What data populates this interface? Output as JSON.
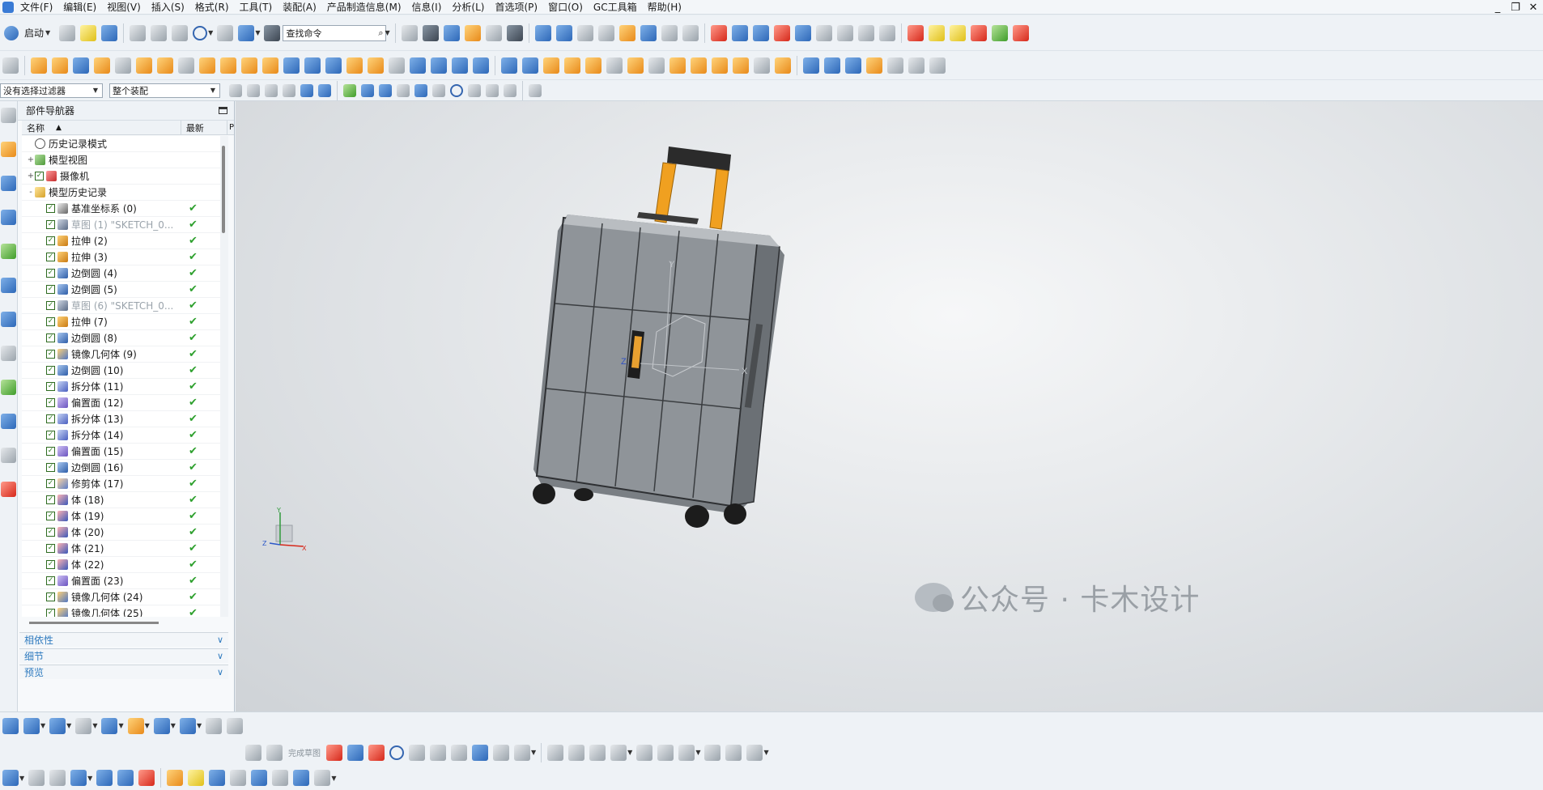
{
  "menu": [
    "文件(F)",
    "编辑(E)",
    "视图(V)",
    "插入(S)",
    "格式(R)",
    "工具(T)",
    "装配(A)",
    "产品制造信息(M)",
    "信息(I)",
    "分析(L)",
    "首选项(P)",
    "窗口(O)",
    "GC工具箱",
    "帮助(H)"
  ],
  "window_controls": [
    "_",
    "❐",
    "✕"
  ],
  "toolbar": {
    "start_label": "启动",
    "search_placeholder": "查找命令",
    "selection_filter": "没有选择过滤器",
    "assembly_scope": "整个装配"
  },
  "navigator": {
    "title": "部件导航器",
    "col_name": "名称",
    "col_latest": "最新",
    "col_extra": "P",
    "nodes": [
      {
        "expander": "",
        "checked": false,
        "icon": "hist",
        "label": "历史记录模式",
        "latest": ""
      },
      {
        "expander": "+",
        "checked": false,
        "icon": "model",
        "label": "模型视图",
        "latest": ""
      },
      {
        "expander": "+",
        "checked": true,
        "icon": "cam",
        "label": "摄像机",
        "latest": ""
      },
      {
        "expander": "-",
        "checked": false,
        "icon": "folder",
        "label": "模型历史记录",
        "latest": ""
      }
    ],
    "features": [
      {
        "icon": "datum",
        "label": "基准坐标系 (0)",
        "grey": false
      },
      {
        "icon": "sketch",
        "label": "草图 (1) \"SKETCH_0...",
        "grey": true
      },
      {
        "icon": "extrude",
        "label": "拉伸 (2)",
        "grey": false
      },
      {
        "icon": "extrude",
        "label": "拉伸 (3)",
        "grey": false
      },
      {
        "icon": "blend",
        "label": "边倒圆 (4)",
        "grey": false
      },
      {
        "icon": "blend",
        "label": "边倒圆 (5)",
        "grey": false
      },
      {
        "icon": "sketch",
        "label": "草图 (6) \"SKETCH_0...",
        "grey": true
      },
      {
        "icon": "extrude",
        "label": "拉伸 (7)",
        "grey": false
      },
      {
        "icon": "blend",
        "label": "边倒圆 (8)",
        "grey": false
      },
      {
        "icon": "mirror",
        "label": "镜像几何体 (9)",
        "grey": false
      },
      {
        "icon": "blend",
        "label": "边倒圆 (10)",
        "grey": false
      },
      {
        "icon": "split",
        "label": "拆分体 (11)",
        "grey": false
      },
      {
        "icon": "offset",
        "label": "偏置面 (12)",
        "grey": false
      },
      {
        "icon": "split",
        "label": "拆分体 (13)",
        "grey": false
      },
      {
        "icon": "split",
        "label": "拆分体 (14)",
        "grey": false
      },
      {
        "icon": "offset",
        "label": "偏置面 (15)",
        "grey": false
      },
      {
        "icon": "blend",
        "label": "边倒圆 (16)",
        "grey": false
      },
      {
        "icon": "trim",
        "label": "修剪体 (17)",
        "grey": false
      },
      {
        "icon": "body",
        "label": "体 (18)",
        "grey": false
      },
      {
        "icon": "body",
        "label": "体 (19)",
        "grey": false
      },
      {
        "icon": "body",
        "label": "体 (20)",
        "grey": false
      },
      {
        "icon": "body",
        "label": "体 (21)",
        "grey": false
      },
      {
        "icon": "body",
        "label": "体 (22)",
        "grey": false
      },
      {
        "icon": "offset",
        "label": "偏置面 (23)",
        "grey": false
      },
      {
        "icon": "mirror",
        "label": "镜像几何体 (24)",
        "grey": false
      },
      {
        "icon": "mirror",
        "label": "镜像几何体 (25)",
        "grey": false
      }
    ],
    "panels": [
      "相依性",
      "细节",
      "预览"
    ]
  },
  "viewport": {
    "axis_labels": {
      "x": "X",
      "y": "Y",
      "z": "Z"
    },
    "watermark": "公众号 · 卡木设计"
  },
  "bottom_toolbar": {
    "finish_sketch": "完成草图"
  },
  "colors": {
    "handle": "#f0a020",
    "suitcase": "#8f9499",
    "check": "#2ea02e",
    "panel_link": "#2f7bbf"
  }
}
